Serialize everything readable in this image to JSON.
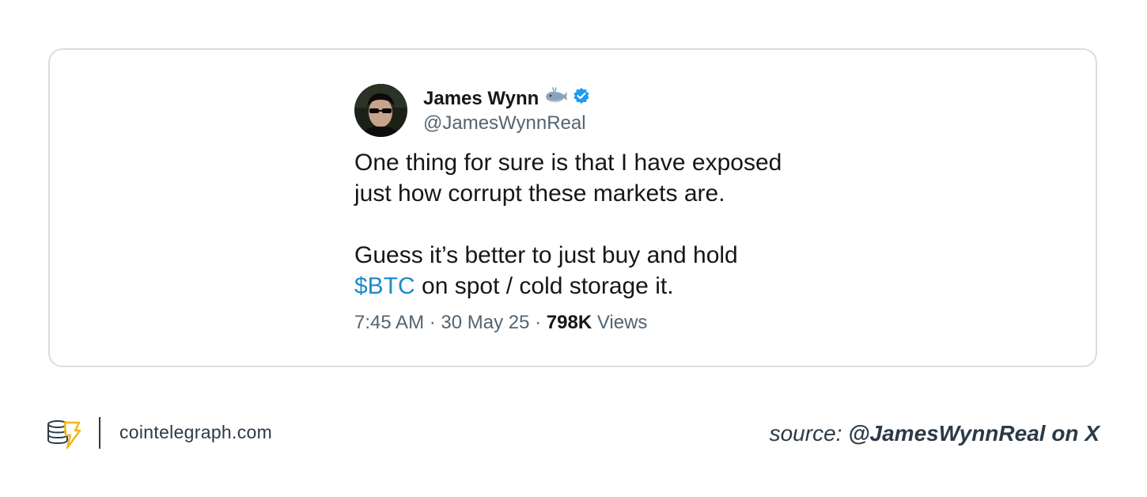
{
  "tweet": {
    "author_name": "James Wynn",
    "handle": "@JamesWynnReal",
    "lines_para1": [
      "One thing for sure is that I have exposed",
      "just how corrupt these markets are."
    ],
    "line3": "Guess it’s better to just buy and hold",
    "cashtag": "$BTC",
    "line4_rest": " on spot / cold storage it.",
    "time": "7:45 AM",
    "date": "30 May 25",
    "separator": " · ",
    "views_count": "798K",
    "views_label": " Views",
    "icons": [
      "whale-emoji-icon",
      "verified-badge-icon"
    ],
    "colors": {
      "cashtag": "#1d8ac9",
      "verified": "#1d9bf0"
    }
  },
  "footer": {
    "site": "cointelegraph.com",
    "source_label": "source: ",
    "source_credit": "@JamesWynnReal on X"
  }
}
